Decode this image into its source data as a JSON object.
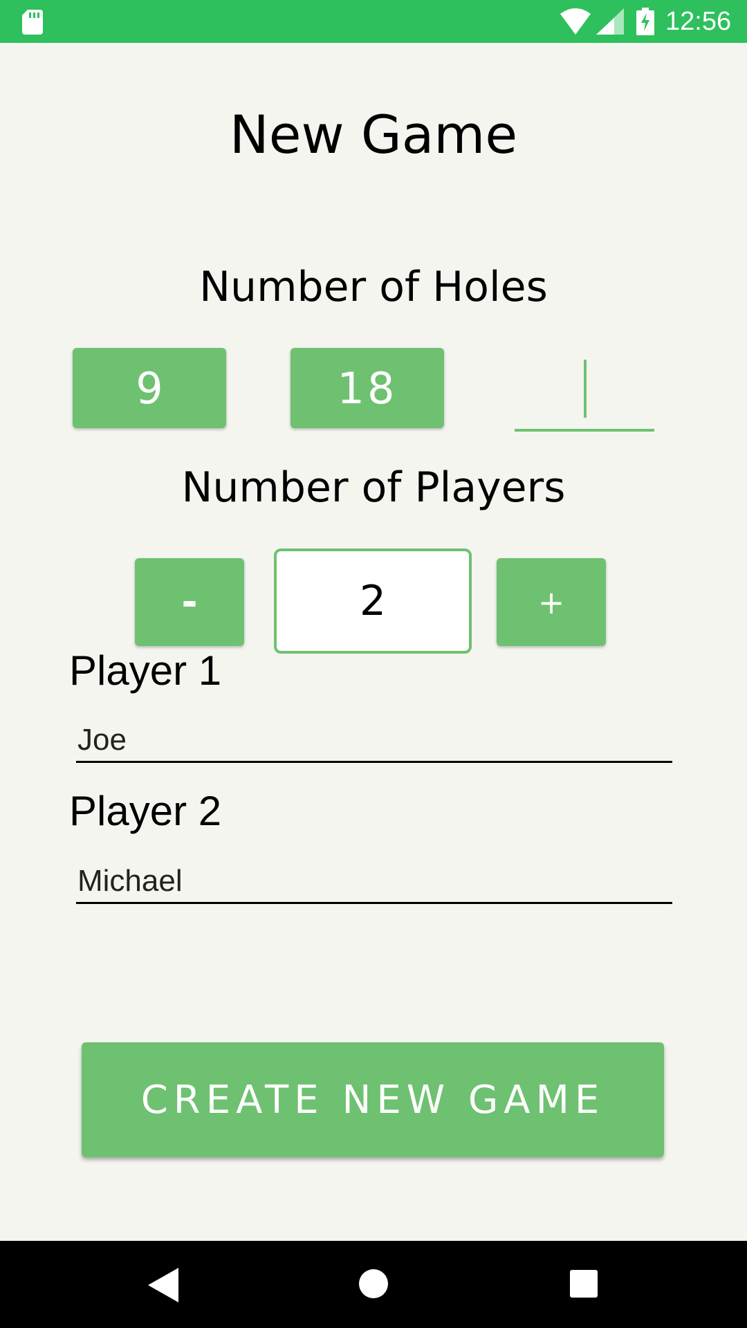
{
  "status_bar": {
    "time": "12:56",
    "icons": [
      "sd-card-icon",
      "wifi-icon",
      "cell-signal-icon",
      "battery-charging-icon"
    ]
  },
  "title": "New Game",
  "holes": {
    "label": "Number of Holes",
    "options": [
      "9",
      "18"
    ],
    "custom_value": ""
  },
  "players": {
    "label": "Number of Players",
    "decrement_label": "-",
    "count": "2",
    "increment_label": "+"
  },
  "player_entries": [
    {
      "label": "Player 1",
      "name": "Joe"
    },
    {
      "label": "Player 2",
      "name": "Michael"
    }
  ],
  "create_button_label": "CREATE NEW GAME",
  "nav_bar": {
    "icons": [
      "back-icon",
      "home-icon",
      "recents-icon"
    ]
  },
  "colors": {
    "status_bar": "#2ec05c",
    "accent": "#6ec170",
    "background": "#f5f5f0",
    "nav_bar": "#000000"
  }
}
